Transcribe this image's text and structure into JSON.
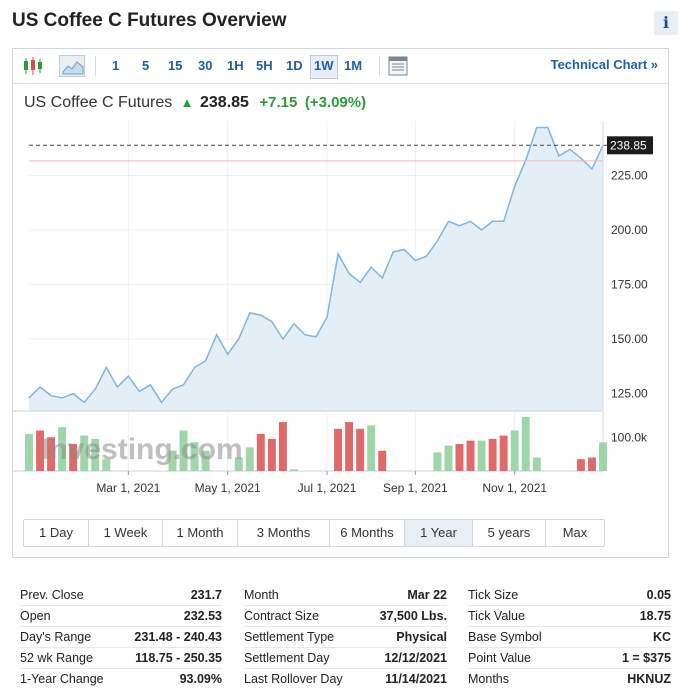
{
  "page": {
    "title": "US Coffee C Futures Overview",
    "info_label": "i"
  },
  "toolbar": {
    "intervals": [
      {
        "label": "1",
        "active": false
      },
      {
        "label": "5",
        "active": false
      },
      {
        "label": "15",
        "active": false
      },
      {
        "label": "30",
        "active": false
      },
      {
        "label": "1H",
        "active": false
      },
      {
        "label": "5H",
        "active": false
      },
      {
        "label": "1D",
        "active": false
      },
      {
        "label": "1W",
        "active": true
      },
      {
        "label": "1M",
        "active": false
      }
    ],
    "technical_chart_label": "Technical Chart »",
    "icons": [
      "candlestick-icon",
      "area-chart-icon",
      "table-view-icon"
    ]
  },
  "quote": {
    "name": "US Coffee C Futures",
    "arrow": "▲",
    "price": "238.85",
    "change": "+7.15",
    "change_pct": "(+3.09%)"
  },
  "watermark": "Investing.com",
  "range_buttons": [
    {
      "label": "1 Day",
      "active": false
    },
    {
      "label": "1 Week",
      "active": false
    },
    {
      "label": "1 Month",
      "active": false
    },
    {
      "label": "3 Months",
      "active": false
    },
    {
      "label": "6 Months",
      "active": false
    },
    {
      "label": "1 Year",
      "active": true
    },
    {
      "label": "5 years",
      "active": false
    },
    {
      "label": "Max",
      "active": false
    }
  ],
  "colors": {
    "price_line": "#7fb6dc",
    "price_fill": "#e4eef7",
    "volume_up": "#9fd6a9",
    "volume_down": "#e06a6a",
    "accent": "#1f5fa8",
    "positive": "#2b9a3a"
  },
  "chart_data": {
    "type": "area",
    "x_tick_labels": [
      "Mar 1, 2021",
      "May 1, 2021",
      "Jul 1, 2021",
      "Sep 1, 2021",
      "Nov 1, 2021"
    ],
    "y_tick_labels": [
      "125.00",
      "150.00",
      "175.00",
      "200.00",
      "225.00"
    ],
    "y_ticks": [
      125,
      150,
      175,
      200,
      225
    ],
    "ylim": [
      117,
      250
    ],
    "last_price_label": "238.85",
    "last_price": 238.85,
    "prev_close": 231.7,
    "price": [
      123,
      128,
      124,
      123,
      125,
      121,
      127,
      137,
      128,
      133,
      126,
      129,
      121,
      127,
      129,
      137,
      140,
      152,
      143,
      150,
      162,
      161,
      158,
      150,
      157,
      152,
      151,
      160,
      189,
      180,
      176,
      183,
      178,
      190,
      191,
      186,
      188,
      195,
      204,
      202,
      204,
      200,
      204,
      204,
      220,
      232,
      247,
      247,
      234,
      237,
      233,
      228,
      238.85
    ],
    "volume_label": "100.0k",
    "volume_ref": 100000,
    "volume": [
      [
        0,
        110000,
        "up"
      ],
      [
        1,
        120000,
        "down"
      ],
      [
        2,
        100000,
        "down"
      ],
      [
        3,
        130000,
        "up"
      ],
      [
        4,
        80000,
        "down"
      ],
      [
        5,
        105000,
        "up"
      ],
      [
        6,
        95000,
        "up"
      ],
      [
        7,
        35000,
        "up"
      ],
      [
        13,
        60000,
        "up"
      ],
      [
        14,
        120000,
        "up"
      ],
      [
        15,
        85000,
        "up"
      ],
      [
        16,
        60000,
        "up"
      ],
      [
        19,
        40000,
        "up"
      ],
      [
        20,
        70000,
        "up"
      ],
      [
        21,
        110000,
        "down"
      ],
      [
        22,
        95000,
        "down"
      ],
      [
        23,
        145000,
        "down"
      ],
      [
        24,
        5000,
        "up"
      ],
      [
        28,
        125000,
        "down"
      ],
      [
        29,
        145000,
        "down"
      ],
      [
        30,
        125000,
        "down"
      ],
      [
        31,
        135000,
        "up"
      ],
      [
        32,
        60000,
        "down"
      ],
      [
        37,
        55000,
        "up"
      ],
      [
        38,
        75000,
        "up"
      ],
      [
        39,
        80000,
        "down"
      ],
      [
        40,
        90000,
        "down"
      ],
      [
        41,
        90000,
        "up"
      ],
      [
        42,
        95000,
        "down"
      ],
      [
        43,
        105000,
        "down"
      ],
      [
        44,
        120000,
        "up"
      ],
      [
        45,
        160000,
        "up"
      ],
      [
        46,
        40000,
        "up"
      ],
      [
        50,
        35000,
        "down"
      ],
      [
        51,
        40000,
        "down"
      ],
      [
        52,
        85000,
        "up"
      ]
    ]
  },
  "stats": {
    "col1": [
      {
        "label": "Prev. Close",
        "value": "231.7"
      },
      {
        "label": "Open",
        "value": "232.53"
      },
      {
        "label": "Day's Range",
        "value": "231.48 - 240.43"
      },
      {
        "label": "52 wk Range",
        "value": "118.75 - 250.35"
      },
      {
        "label": "1-Year Change",
        "value": "93.09%"
      }
    ],
    "col2": [
      {
        "label": "Month",
        "value": "Mar 22"
      },
      {
        "label": "Contract Size",
        "value": "37,500 Lbs."
      },
      {
        "label": "Settlement Type",
        "value": "Physical"
      },
      {
        "label": "Settlement Day",
        "value": "12/12/2021"
      },
      {
        "label": "Last Rollover Day",
        "value": "11/14/2021"
      }
    ],
    "col3": [
      {
        "label": "Tick Size",
        "value": "0.05"
      },
      {
        "label": "Tick Value",
        "value": "18.75"
      },
      {
        "label": "Base Symbol",
        "value": "KC"
      },
      {
        "label": "Point Value",
        "value": "1 = $375"
      },
      {
        "label": "Months",
        "value": "HKNUZ"
      }
    ]
  }
}
